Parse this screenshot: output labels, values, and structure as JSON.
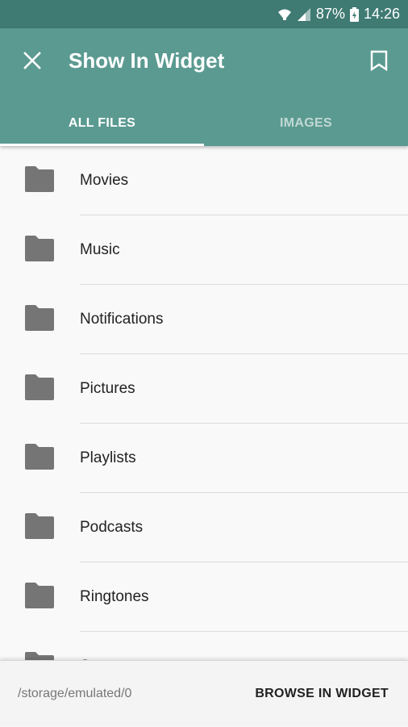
{
  "status_bar": {
    "battery": "87%",
    "time": "14:26",
    "icons": [
      "wifi-icon",
      "signal-icon",
      "battery-icon"
    ]
  },
  "app_bar": {
    "title": "Show In Widget",
    "close_icon": "close-icon",
    "bookmark_icon": "bookmark-icon",
    "color": "#5b9a91"
  },
  "tabs": [
    {
      "label": "ALL FILES",
      "active": true
    },
    {
      "label": "IMAGES",
      "active": false
    }
  ],
  "folders": [
    {
      "name": "Movies",
      "icon": "folder-icon"
    },
    {
      "name": "Music",
      "icon": "folder-icon"
    },
    {
      "name": "Notifications",
      "icon": "folder-icon"
    },
    {
      "name": "Pictures",
      "icon": "folder-icon"
    },
    {
      "name": "Playlists",
      "icon": "folder-icon"
    },
    {
      "name": "Podcasts",
      "icon": "folder-icon"
    },
    {
      "name": "Ringtones",
      "icon": "folder-icon"
    },
    {
      "name": "S",
      "icon": "folder-icon"
    }
  ],
  "bottom_bar": {
    "path": "/storage/emulated/0",
    "action_label": "BROWSE IN WIDGET"
  }
}
